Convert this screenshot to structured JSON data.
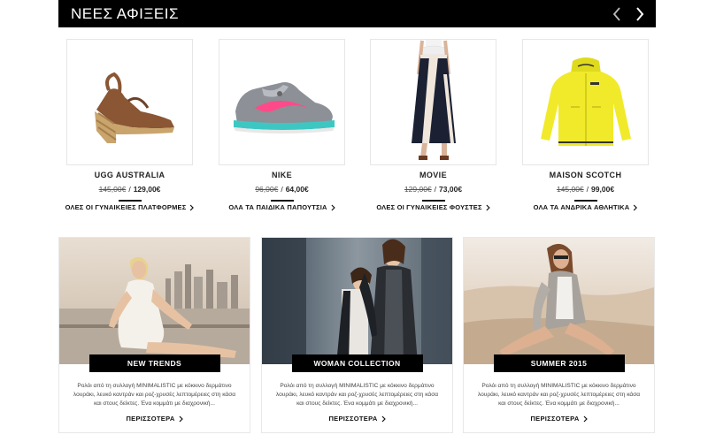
{
  "header": {
    "title": "ΝΕΕΣ ΑΦΙΞΕΙΣ",
    "prev_icon": "chevron-left-icon",
    "next_icon": "chevron-right-icon"
  },
  "products": [
    {
      "brand": "UGG AUSTRALIA",
      "old_price": "145,00€",
      "separator": "/",
      "new_price": "129,00€",
      "category_link": "ΟΛΕΣ ΟΙ ΓΥΝΑΙΚΕΙΕΣ ΠΛΑΤΦΟΡΜΕΣ",
      "image": "wedge-sandal"
    },
    {
      "brand": "NIKE",
      "old_price": "96,00€",
      "separator": "/",
      "new_price": "64,00€",
      "category_link": "ΟΛΑ ΤΑ ΠΑΙΔΙΚΑ ΠΑΠΟΥΤΣΙΑ",
      "image": "sneaker"
    },
    {
      "brand": "MOVIE",
      "old_price": "129,00€",
      "separator": "/",
      "new_price": "73,00€",
      "category_link": "ΟΛΕΣ ΟΙ ΓΥΝΑΙΚΕΙΕΣ ΦΟΥΣΤΕΣ",
      "image": "maxi-skirt"
    },
    {
      "brand": "MAISON SCOTCH",
      "old_price": "145,00€",
      "separator": "/",
      "new_price": "99,00€",
      "category_link": "ΟΛΑ ΤΑ ΑΝΔΡΙΚΑ ΑΘΛΗΤΙΚΑ",
      "image": "yellow-jacket"
    }
  ],
  "promos": [
    {
      "label": "NEW TRENDS",
      "description": "Ρολόι από τη συλλογή MINIMALISTIC με κόκκινο δερμάτινο λουράκι, λευκό καντράν και ροζ-χρυσές λεπτομέρειες στη κάσα και στους δείκτες. Ένα κομμάτι με διαχρονική...",
      "more": "ΠΕΡΙΣΣΟΤΕΡΑ"
    },
    {
      "label": "WOMAN COLLECTION",
      "description": "Ρολόι από τη συλλογή MINIMALISTIC με κόκκινο δερμάτινο λουράκι, λευκό καντράν και ροζ-χρυσές λεπτομέρειες στη κάσα και στους δείκτες. Ένα κομμάτι με διαχρονική...",
      "more": "ΠΕΡΙΣΣΟΤΕΡΑ"
    },
    {
      "label": "SUMMER 2015",
      "description": "Ρολόι από τη συλλογή MINIMALISTIC με κόκκινο δερμάτινο λουράκι, λευκό καντράν και ροζ-χρυσές λεπτομέρειες στη κάσα και στους δείκτες. Ένα κομμάτι με διαχρονική...",
      "more": "ΠΕΡΙΣΣΟΤΕΡΑ"
    }
  ],
  "colors": {
    "header_bg": "#000000",
    "text": "#222222",
    "label_bg": "#000000",
    "jacket": "#f0ea2a",
    "sneaker_accent": "#ff4a8a"
  }
}
